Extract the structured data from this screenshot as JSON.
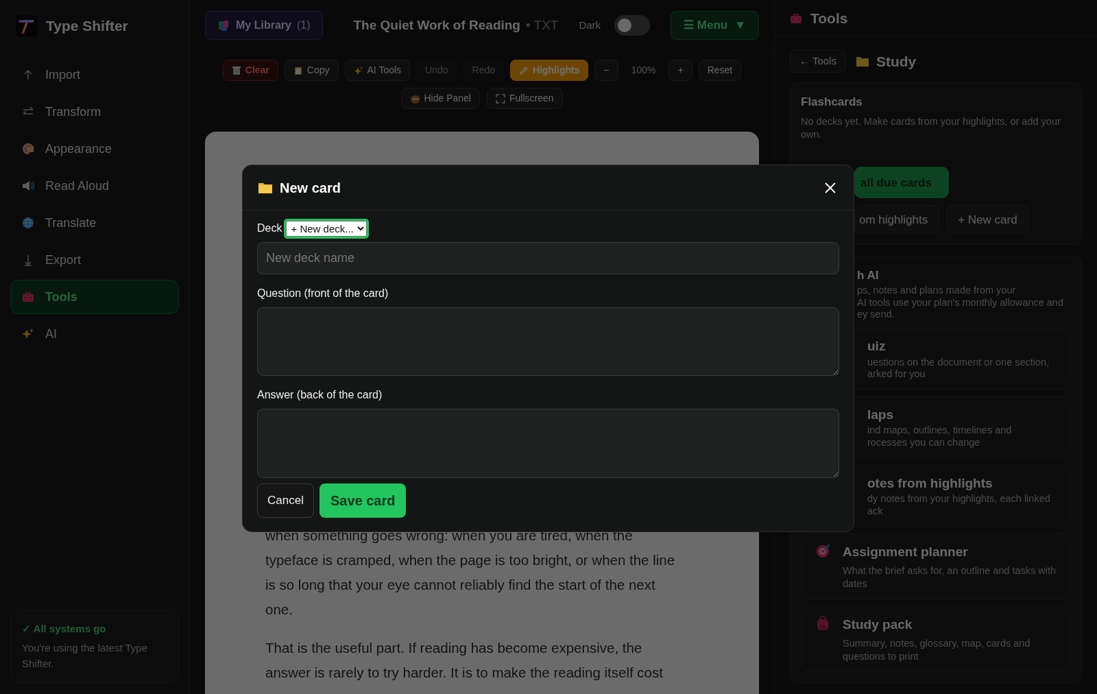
{
  "app": {
    "name": "Type Shifter"
  },
  "sidebar": {
    "items": [
      {
        "label": "Import",
        "selected": false
      },
      {
        "label": "Transform",
        "selected": false
      },
      {
        "label": "Appearance",
        "selected": false
      },
      {
        "label": "Read Aloud",
        "selected": false
      },
      {
        "label": "Translate",
        "selected": false
      },
      {
        "label": "Export",
        "selected": false
      },
      {
        "label": "Tools",
        "selected": true
      },
      {
        "label": "AI",
        "selected": false
      }
    ],
    "status": {
      "title": "✓ All systems go",
      "text": "You're using the latest Type Shifter."
    }
  },
  "topbar": {
    "library": {
      "label": "My Library",
      "count": "(1)"
    },
    "document": {
      "title": "The Quiet Work of Reading",
      "format": "• TXT"
    },
    "theme_toggle": {
      "label": "Dark",
      "on": false
    },
    "menu": {
      "label": "☰ Menu",
      "caret": "▼"
    }
  },
  "toolbar": [
    {
      "kind": "danger",
      "label": "Clear",
      "disabled": false
    },
    {
      "kind": "plain",
      "label": "Copy",
      "disabled": false
    },
    {
      "kind": "plain",
      "label": "AI Tools",
      "disabled": false
    },
    {
      "kind": "plain",
      "label": "Undo",
      "disabled": true
    },
    {
      "kind": "plain",
      "label": "Redo",
      "disabled": true
    },
    {
      "kind": "highlight",
      "label": "Highlights",
      "disabled": false
    },
    {
      "kind": "plain",
      "label": "−",
      "disabled": false
    },
    {
      "kind": "reading",
      "label": "100%"
    },
    {
      "kind": "plain",
      "label": "+",
      "disabled": false
    },
    {
      "kind": "plain",
      "label": "Reset",
      "disabled": false
    }
  ],
  "toolbar_row_2": [
    {
      "label": "Hide Panel"
    },
    {
      "label": "Fullscreen"
    }
  ],
  "document": {
    "paragraphs": [
      "when something goes wrong: when you are tired, when the typeface is cramped, when the page is too bright, or when the line is so long that your eye cannot reliably find the start of the next one.",
      "That is the useful part. If reading has become expensive, the answer is rarely to try harder. It is to make the reading itself cost"
    ]
  },
  "panel": {
    "title": "Tools",
    "back": "← Tools",
    "section": "Study",
    "flashcards": {
      "title": "Flashcards",
      "text": "No decks yet. Make cards from your highlights, or add your own.",
      "buttons": [
        {
          "label": "all due cards",
          "kind": "primary"
        },
        {
          "label": "om highlights",
          "kind": "secondary"
        },
        {
          "label": "+ New card",
          "kind": "secondary"
        }
      ]
    },
    "ai_group": {
      "title": "h AI",
      "lines": [
        "ps, notes and plans made from your",
        "AI tools use your plan's monthly allowance and",
        "ey send."
      ]
    },
    "tools": [
      {
        "kind": "covered",
        "title": "uiz",
        "lines": [
          "uestions on the document or one section,",
          "arked for you"
        ]
      },
      {
        "kind": "covered",
        "title": "laps",
        "lines": [
          "ind maps, outlines, timelines and",
          "rocesses you can change"
        ]
      },
      {
        "kind": "covered",
        "title": "otes from highlights",
        "lines": [
          "dy notes from your highlights, each linked",
          "ack"
        ]
      },
      {
        "kind": "tool",
        "title": "Assignment planner",
        "description": "What the brief asks for, an outline and tasks with dates"
      },
      {
        "kind": "tool",
        "title": "Study pack",
        "description": "Summary, notes, glossary, map, cards and questions to print"
      }
    ]
  },
  "modal": {
    "title": "New card",
    "deck_label": "Deck",
    "deck_select": "+ New deck...",
    "deck_name_placeholder": "New deck name",
    "question_label": "Question (front of the card)",
    "answer_label": "Answer (back of the card)",
    "cancel": "Cancel",
    "save": "Save card"
  }
}
